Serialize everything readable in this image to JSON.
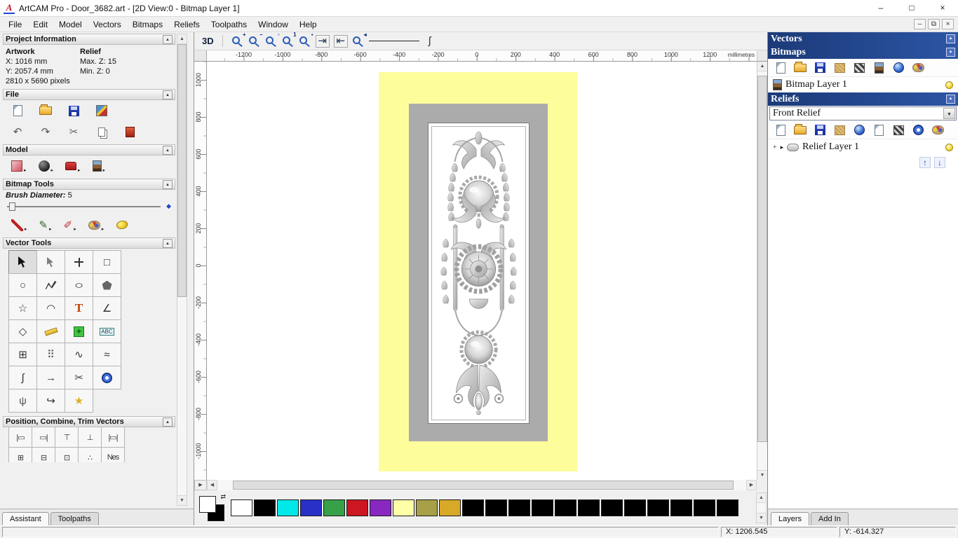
{
  "titlebar": {
    "title": "ArtCAM Pro - Door_3682.art - [2D View:0 - Bitmap Layer 1]",
    "logo": "A",
    "minimize": "–",
    "maximize": "□",
    "close": "×"
  },
  "menubar": {
    "items": [
      "File",
      "Edit",
      "Model",
      "Vectors",
      "Bitmaps",
      "Reliefs",
      "Toolpaths",
      "Window",
      "Help"
    ],
    "mdi_minimize": "–",
    "mdi_restore": "⧉",
    "mdi_close": "×"
  },
  "ui": {
    "collapse": "▲",
    "dropdown": "▼",
    "up": "▲",
    "down": "▼",
    "left": "◀",
    "right": "▶",
    "expand": "▸",
    "plus": "+",
    "link": "⇄",
    "arrow_up": "↑",
    "arrow_down": "↓",
    "pan": "▶"
  },
  "left_panel": {
    "project_info": {
      "title": "Project Information",
      "artwork": "Artwork",
      "relief": "Relief",
      "x": "X: 1016 mm",
      "y": "Y: 2057.4 mm",
      "max_z": "Max. Z: 15",
      "min_z": "Min. Z: 0",
      "pixels": "2810 x 5690 pixels"
    },
    "file": {
      "title": "File",
      "row1": [
        {
          "name": "new-model-button",
          "shape": "s-page"
        },
        {
          "name": "open-model-button",
          "shape": "s-folder"
        },
        {
          "name": "save-model-button",
          "shape": "s-save"
        },
        {
          "name": "import-export-button",
          "shape": "s-multi"
        }
      ],
      "row2": [
        {
          "name": "undo-button",
          "g": "↶",
          "c": "#555555"
        },
        {
          "name": "redo-button",
          "g": "↷",
          "c": "#555555"
        },
        {
          "name": "cut-button",
          "g": "✂",
          "c": "#666666"
        },
        {
          "name": "paste-button",
          "shape": "s-copy"
        },
        {
          "name": "package-button",
          "shape": "s-red"
        }
      ]
    },
    "model": {
      "title": "Model",
      "row": [
        {
          "name": "adjust-model-button",
          "shape": "s-pink",
          "arrow": true
        },
        {
          "name": "texture-relief-button",
          "shape": "s-dark",
          "arrow": true
        },
        {
          "name": "stamp-model-button",
          "shape": "s-stamp",
          "arrow": true
        },
        {
          "name": "greyscale-from-model-button",
          "shape": "s-mona",
          "arrow": true
        }
      ]
    },
    "bitmap_tools": {
      "title": "Bitmap Tools",
      "brush_label": "Brush Diameter:",
      "brush_value": "5",
      "row": [
        {
          "name": "paint-tool",
          "shape": "s-brush",
          "arrow": true
        },
        {
          "name": "draw-tool",
          "g": "✎",
          "c": "#2a6a2a",
          "arrow": true
        },
        {
          "name": "paint-selective-tool",
          "g": "✐",
          "c": "#c03030",
          "arrow": true
        },
        {
          "name": "colour-palette-tool",
          "shape": "s-pal",
          "arrow": true
        },
        {
          "name": "flood-fill-tool",
          "shape": "s-blob"
        }
      ]
    },
    "vector_tools": {
      "title": "Vector Tools",
      "cells": [
        {
          "name": "select-vectors-tool",
          "shape": "s-cursor",
          "pressed": true
        },
        {
          "name": "node-editing-tool",
          "shape": "s-cursor2"
        },
        {
          "name": "transform-vectors-tool",
          "shape": "s-move"
        },
        {
          "name": "create-rectangle-tool",
          "g": "□",
          "c": "#333333"
        },
        {
          "name": "create-circle-tool",
          "g": "○",
          "c": "#333333"
        },
        {
          "name": "create-polyline-tool",
          "shape": "s-poly"
        },
        {
          "name": "create-ellipse-tool",
          "g": "○",
          "gcls": "stretch",
          "c": "#333333"
        },
        {
          "name": "create-polygon-tool",
          "shape": "s-pent"
        },
        {
          "name": "create-star-tool",
          "g": "☆",
          "c": "#333333"
        },
        {
          "name": "create-arc-tool",
          "g": "◠",
          "c": "#333333"
        },
        {
          "name": "create-text-tool",
          "g": "T",
          "gcls": "ttool"
        },
        {
          "name": "measure-tool",
          "g": "∠",
          "c": "#333333"
        },
        {
          "name": "offset-vectors-tool",
          "g": "◇",
          "c": "#333333"
        },
        {
          "name": "dimension-tool",
          "shape": "s-ruler"
        },
        {
          "name": "paste-vector-tool",
          "shape": "s-gplus",
          "g": "+",
          "gcls": "overlay",
          "c": "#0a5a0a"
        },
        {
          "name": "wrap-text-tool",
          "g": "ABC",
          "gcls": "abc"
        },
        {
          "name": "block-copy-tool",
          "g": "⊞",
          "c": "#333333"
        },
        {
          "name": "array-copy-tool",
          "g": "⠿",
          "c": "#555555"
        },
        {
          "name": "fit-curves-tool",
          "g": "∿",
          "c": "#333333"
        },
        {
          "name": "smooth-polyline-tool",
          "g": "≈",
          "c": "#333333"
        },
        {
          "name": "join-vectors-tool",
          "g": "∫",
          "c": "#333333"
        },
        {
          "name": "vector-doctor-tool",
          "g": "→",
          "gcls": "boldg",
          "c": "#333333"
        },
        {
          "name": "trim-vectors-tool",
          "g": "✂",
          "c": "#444444"
        },
        {
          "name": "interactive-distort-tool",
          "shape": "s-torus"
        },
        {
          "name": "envelope-distort-tool",
          "g": "ψ",
          "c": "#555555"
        },
        {
          "name": "fillet-tool",
          "g": "↪",
          "c": "#333333"
        },
        {
          "name": "star-wizard-tool",
          "g": "★",
          "c": "#e0b020"
        }
      ]
    },
    "position": {
      "title": "Position, Combine, Trim Vectors",
      "cells": [
        {
          "name": "align-left-tool",
          "g": "|▭"
        },
        {
          "name": "align-right-tool",
          "g": "▭|"
        },
        {
          "name": "align-top-tool",
          "g": "⊤"
        },
        {
          "name": "align-bottom-tool",
          "g": "⊥"
        },
        {
          "name": "align-centre-tool",
          "g": "|▭|"
        },
        {
          "name": "group-vectors-tool",
          "g": "⊞"
        },
        {
          "name": "ungroup-vectors-tool",
          "g": "⊟"
        },
        {
          "name": "weld-vectors-tool",
          "g": "⊡"
        },
        {
          "name": "array-tool",
          "g": "∴"
        },
        {
          "name": "nest-tool",
          "g": "Nes"
        }
      ]
    },
    "tabs": [
      {
        "label": "Assistant"
      },
      {
        "label": "Toolpaths"
      }
    ]
  },
  "canvas": {
    "toolbar": {
      "view3d": "3D",
      "tools": [
        {
          "name": "zoom-in-button",
          "shape": "s-mag",
          "mod": "+"
        },
        {
          "name": "zoom-out-button",
          "shape": "s-mag",
          "mod": "−"
        },
        {
          "name": "zoom-page-button",
          "shape": "s-mag",
          "mod": "▫"
        },
        {
          "name": "zoom-100-button",
          "shape": "s-mag",
          "mod": "1"
        },
        {
          "name": "zoom-objects-button",
          "shape": "s-mag",
          "mod": "▪"
        },
        {
          "name": "snap-left-button",
          "g": "⇥",
          "c": "#223355",
          "cls": "bordered"
        },
        {
          "name": "snap-right-button",
          "g": "⇤",
          "c": "#223355",
          "cls": "bordered"
        },
        {
          "name": "zoom-previous-button",
          "shape": "s-mag",
          "mod": "◂"
        },
        {
          "name": "line-width-preview",
          "shape": "s-line"
        },
        {
          "name": "curve-preview",
          "g": "ʃ",
          "c": "#333333"
        }
      ]
    },
    "h_ticks": [
      "-1200",
      "-1000",
      "-800",
      "-600",
      "-400",
      "-200",
      "0",
      "200",
      "400",
      "600",
      "800",
      "1000",
      "1200"
    ],
    "v_ticks": [
      "1000",
      "800",
      "600",
      "400",
      "200",
      "0",
      "-200",
      "-400",
      "-600",
      "-800",
      "-1000"
    ],
    "unit": "millimetres"
  },
  "palette": {
    "colors": [
      "#ffffff",
      "#000000",
      "#00e8e8",
      "#2830c8",
      "#38a048",
      "#cc1622",
      "#8828c0",
      "#ffffa8",
      "#a8a048",
      "#d8a828",
      "#000000",
      "#000000",
      "#000000",
      "#000000",
      "#000000",
      "#000000",
      "#000000",
      "#000000",
      "#000000",
      "#000000",
      "#000000",
      "#000000"
    ]
  },
  "right_panel": {
    "vectors_title": "Vectors",
    "bitmaps_title": "Bitmaps",
    "bitmap_toolbar": [
      {
        "name": "new-bitmap-layer-button",
        "shape": "s-page"
      },
      {
        "name": "load-bitmap-layer-button",
        "shape": "s-folder"
      },
      {
        "name": "save-bitmap-layer-button",
        "shape": "s-save"
      },
      {
        "name": "texture-bitmap-button",
        "shape": "s-tan"
      },
      {
        "name": "contrast-bitmap-button",
        "shape": "s-chk"
      },
      {
        "name": "greyscale-bitmap-button",
        "shape": "s-mona"
      },
      {
        "name": "sphere-bitmap-button",
        "shape": "s-swirl"
      },
      {
        "name": "palette-bitmap-button",
        "shape": "s-pal"
      }
    ],
    "bitmap_layer": {
      "label": "Bitmap Layer 1"
    },
    "reliefs_title": "Reliefs",
    "relief_combo": "Front Relief",
    "relief_toolbar": [
      {
        "name": "new-relief-layer-button",
        "shape": "s-page"
      },
      {
        "name": "load-relief-layer-button",
        "shape": "s-folder"
      },
      {
        "name": "save-relief-layer-button",
        "shape": "s-save"
      },
      {
        "name": "texture-relief-layer-button",
        "shape": "s-tan"
      },
      {
        "name": "swirl-relief-button",
        "shape": "s-swirl"
      },
      {
        "name": "duplicate-relief-button",
        "shape": "s-page"
      },
      {
        "name": "mirror-relief-button",
        "shape": "s-chk"
      },
      {
        "name": "sphere-relief-button",
        "shape": "s-torus"
      },
      {
        "name": "palette-relief-button",
        "shape": "s-pal"
      }
    ],
    "relief_layer": {
      "label": "Relief Layer 1"
    },
    "tabs": [
      {
        "label": "Layers"
      },
      {
        "label": "Add In"
      }
    ]
  },
  "status": {
    "x": "X: 1206.545",
    "y": "Y: -614.327"
  }
}
